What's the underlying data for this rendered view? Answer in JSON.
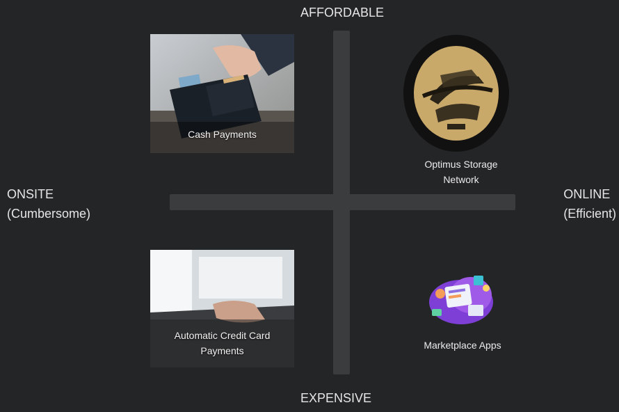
{
  "axes": {
    "top": "AFFORDABLE",
    "bottom": "EXPENSIVE",
    "left_line1": "ONSITE",
    "left_line2": "(Cumbersome)",
    "right_line1": "ONLINE",
    "right_line2": "(Efficient)"
  },
  "quadrants": {
    "top_left": {
      "caption": "Cash Payments",
      "image": "wallet-photo"
    },
    "top_right": {
      "caption_line1": "Optimus Storage",
      "caption_line2": "Network",
      "image": "optimus-logo"
    },
    "bottom_left": {
      "caption_line1": "Automatic Credit Card",
      "caption_line2": "Payments",
      "image": "laptop-typing-photo"
    },
    "bottom_right": {
      "caption": "Marketplace Apps",
      "image": "marketplace-apps-illustration"
    }
  },
  "colors": {
    "background": "#232526",
    "axis_cross": "#3a3c3d",
    "logo_gold": "#c9a96a"
  }
}
